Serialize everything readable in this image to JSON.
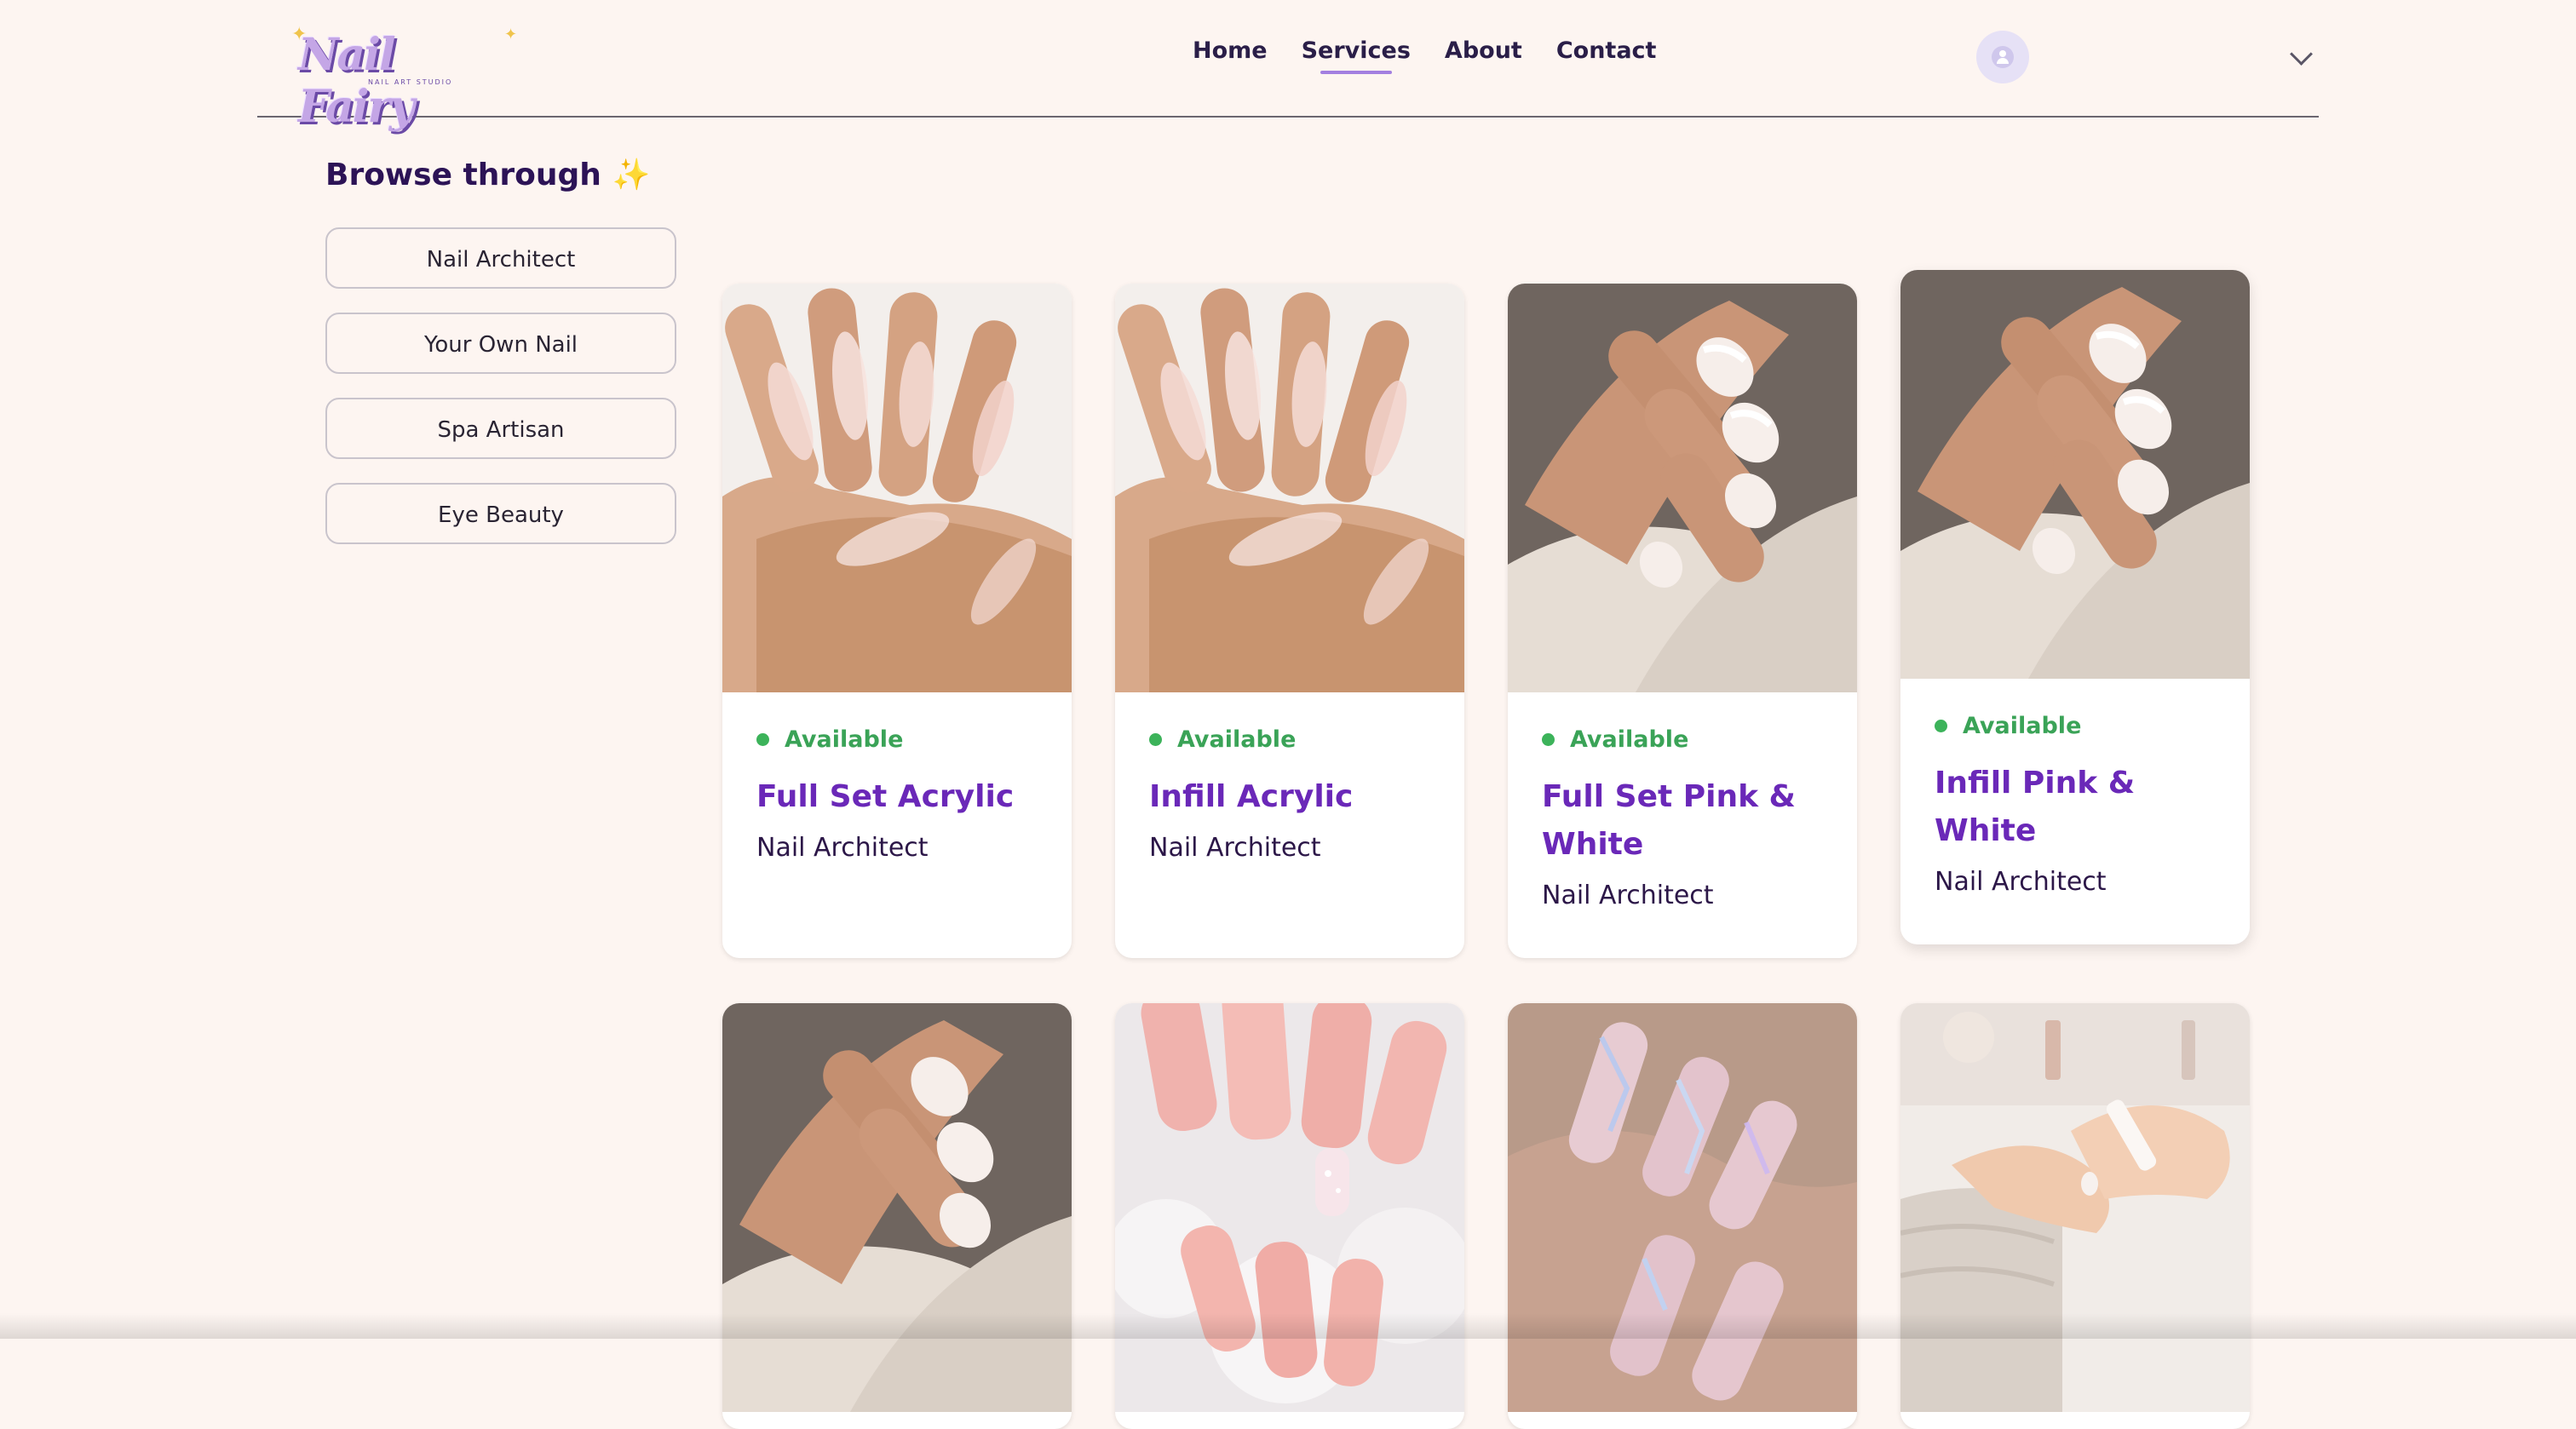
{
  "brand": {
    "name": "Nail Fairy",
    "tagline": "NAIL ART STUDIO"
  },
  "nav": {
    "items": [
      "Home",
      "Services",
      "About",
      "Contact"
    ],
    "active": "Services"
  },
  "sidebar": {
    "title": "Browse through",
    "title_emoji": "✨",
    "categories": [
      "Nail Architect",
      "Your Own Nail",
      "Spa Artisan",
      "Eye Beauty"
    ]
  },
  "services": [
    {
      "status": "Available",
      "title": "Full Set Acrylic",
      "category": "Nail Architect",
      "image": "nude-stiletto-acrylic-nails"
    },
    {
      "status": "Available",
      "title": "Infill Acrylic",
      "category": "Nail Architect",
      "image": "nude-stiletto-acrylic-nails"
    },
    {
      "status": "Available",
      "title": "Full Set Pink & White",
      "category": "Nail Architect",
      "image": "french-tip-nails-on-satin"
    },
    {
      "status": "Available",
      "title": "Infill Pink & White",
      "category": "Nail Architect",
      "image": "french-tip-nails-on-satin"
    },
    {
      "image": "french-tip-nails-on-satin"
    },
    {
      "image": "pink-ombre-nails-with-glitter"
    },
    {
      "image": "holographic-chrome-nails"
    },
    {
      "image": "manicure-in-progress"
    }
  ],
  "colors": {
    "background": "#fdf5f1",
    "accent_purple": "#6a28b8",
    "nav_underline": "#a37fe0",
    "available_green": "#3cb35a"
  }
}
